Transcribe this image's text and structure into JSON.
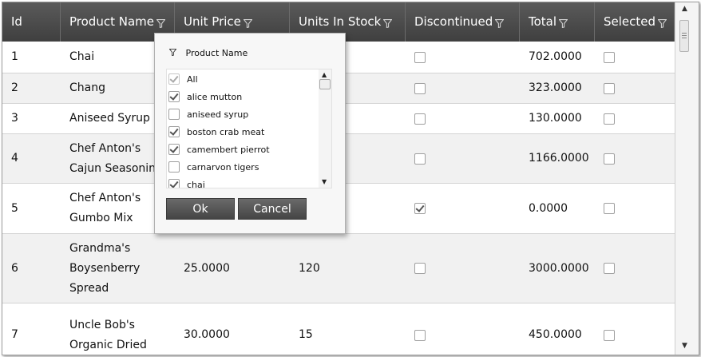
{
  "columns": [
    {
      "label": "Id",
      "filter": false
    },
    {
      "label": "Product Name",
      "filter": true
    },
    {
      "label": "Unit Price",
      "filter": true
    },
    {
      "label": "Units In Stock",
      "filter": true
    },
    {
      "label": "Discontinued",
      "filter": true
    },
    {
      "label": "Total",
      "filter": true
    },
    {
      "label": "Selected",
      "filter": true
    }
  ],
  "rows": [
    {
      "id": "1",
      "name_lines": [
        "Chai"
      ],
      "unit_price": "",
      "units_in_stock": "",
      "discontinued": false,
      "total": "702.0000",
      "selected": false
    },
    {
      "id": "2",
      "name_lines": [
        "Chang"
      ],
      "unit_price": "",
      "units_in_stock": "",
      "discontinued": false,
      "total": "323.0000",
      "selected": false
    },
    {
      "id": "3",
      "name_lines": [
        "Aniseed Syrup"
      ],
      "unit_price": "",
      "units_in_stock": "",
      "discontinued": false,
      "total": "130.0000",
      "selected": false
    },
    {
      "id": "4",
      "name_lines": [
        "Chef Anton's",
        "Cajun Seasonin"
      ],
      "unit_price": "",
      "units_in_stock": "",
      "discontinued": false,
      "total": "1166.0000",
      "selected": false
    },
    {
      "id": "5",
      "name_lines": [
        "Chef Anton's",
        "Gumbo Mix"
      ],
      "unit_price": "",
      "units_in_stock": "",
      "discontinued": true,
      "total": "0.0000",
      "selected": false
    },
    {
      "id": "6",
      "name_lines": [
        "Grandma's",
        "Boysenberry",
        "Spread"
      ],
      "unit_price": "25.0000",
      "units_in_stock": "120",
      "discontinued": false,
      "total": "3000.0000",
      "selected": false
    },
    {
      "id": "7",
      "name_lines": [
        "Uncle Bob's",
        "Organic Dried"
      ],
      "unit_price": "30.0000",
      "units_in_stock": "15",
      "discontinued": false,
      "total": "450.0000",
      "selected": false
    }
  ],
  "filter_popup": {
    "title": "Product Name",
    "items": [
      {
        "label": "All",
        "checked": true,
        "dim": true
      },
      {
        "label": "alice mutton",
        "checked": true
      },
      {
        "label": "aniseed syrup",
        "checked": false
      },
      {
        "label": "boston crab meat",
        "checked": true
      },
      {
        "label": "camembert pierrot",
        "checked": true
      },
      {
        "label": "carnarvon tigers",
        "checked": false
      },
      {
        "label": "chai",
        "checked": true
      }
    ],
    "ok_label": "Ok",
    "cancel_label": "Cancel"
  },
  "colors": {
    "header_bg": "#4a4a4a",
    "alt_row": "#f1f1f1",
    "header_text": "#ffffff"
  }
}
